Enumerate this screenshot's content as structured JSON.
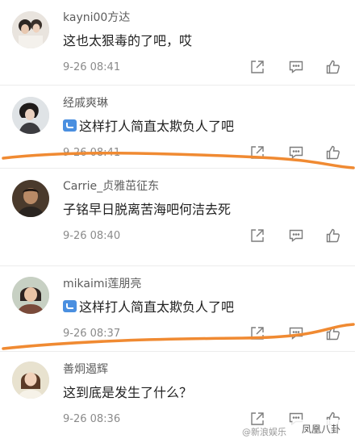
{
  "comments": [
    {
      "user": "kayni00方达",
      "text": "这也太狠毒的了吧，哎",
      "time": "9-26 08:41",
      "badge": false
    },
    {
      "user": "经戚爽琳",
      "text": "这样打人简直太欺负人了吧",
      "time": "9-26 08:41",
      "badge": true
    },
    {
      "user": "Carrie_贞雅茁征东",
      "text": "子铭早日脱离苦海吧何洁去死",
      "time": "9-26 08:40",
      "badge": false
    },
    {
      "user": "mikaimi莲朋亮",
      "text": "这样打人简直太欺负人了吧",
      "time": "9-26 08:37",
      "badge": true
    },
    {
      "user": "善炯遏辉",
      "text": "这到底是发生了什么？",
      "time": "9-26 08:36",
      "badge": false
    }
  ],
  "watermark": {
    "text": "@新浪娱乐",
    "logo_text": "凤凰八卦"
  },
  "icons": {
    "share": "share-icon",
    "reply": "comment-icon",
    "like": "thumbs-up-icon",
    "verified": "verified-badge-icon"
  },
  "colors": {
    "underline": "#f08a32",
    "text": "#222222",
    "username": "#5c5c5c",
    "time": "#8a8a8a",
    "badge": "#4a8fe0"
  }
}
